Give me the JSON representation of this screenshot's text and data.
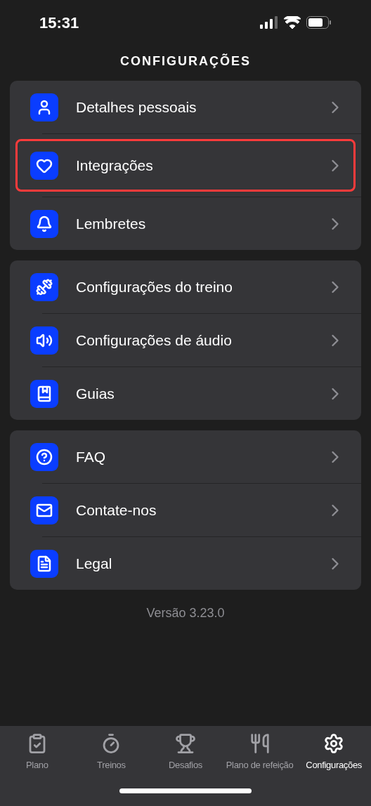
{
  "status_bar": {
    "time": "15:31"
  },
  "header": {
    "title": "CONFIGURAÇÕES"
  },
  "groups": [
    {
      "items": [
        {
          "label": "Detalhes pessoais",
          "highlighted": false
        },
        {
          "label": "Integrações",
          "highlighted": true
        },
        {
          "label": "Lembretes",
          "highlighted": false
        }
      ]
    },
    {
      "items": [
        {
          "label": "Configurações do treino",
          "highlighted": false
        },
        {
          "label": "Configurações de áudio",
          "highlighted": false
        },
        {
          "label": "Guias",
          "highlighted": false
        }
      ]
    },
    {
      "items": [
        {
          "label": "FAQ",
          "highlighted": false
        },
        {
          "label": "Contate-nos",
          "highlighted": false
        },
        {
          "label": "Legal",
          "highlighted": false
        }
      ]
    }
  ],
  "version": "Versão 3.23.0",
  "tab_bar": [
    {
      "label": "Plano",
      "selected": false
    },
    {
      "label": "Treinos",
      "selected": false
    },
    {
      "label": "Desafios",
      "selected": false
    },
    {
      "label": "Plano de refeição",
      "selected": false
    },
    {
      "label": "Configurações",
      "selected": true
    }
  ]
}
